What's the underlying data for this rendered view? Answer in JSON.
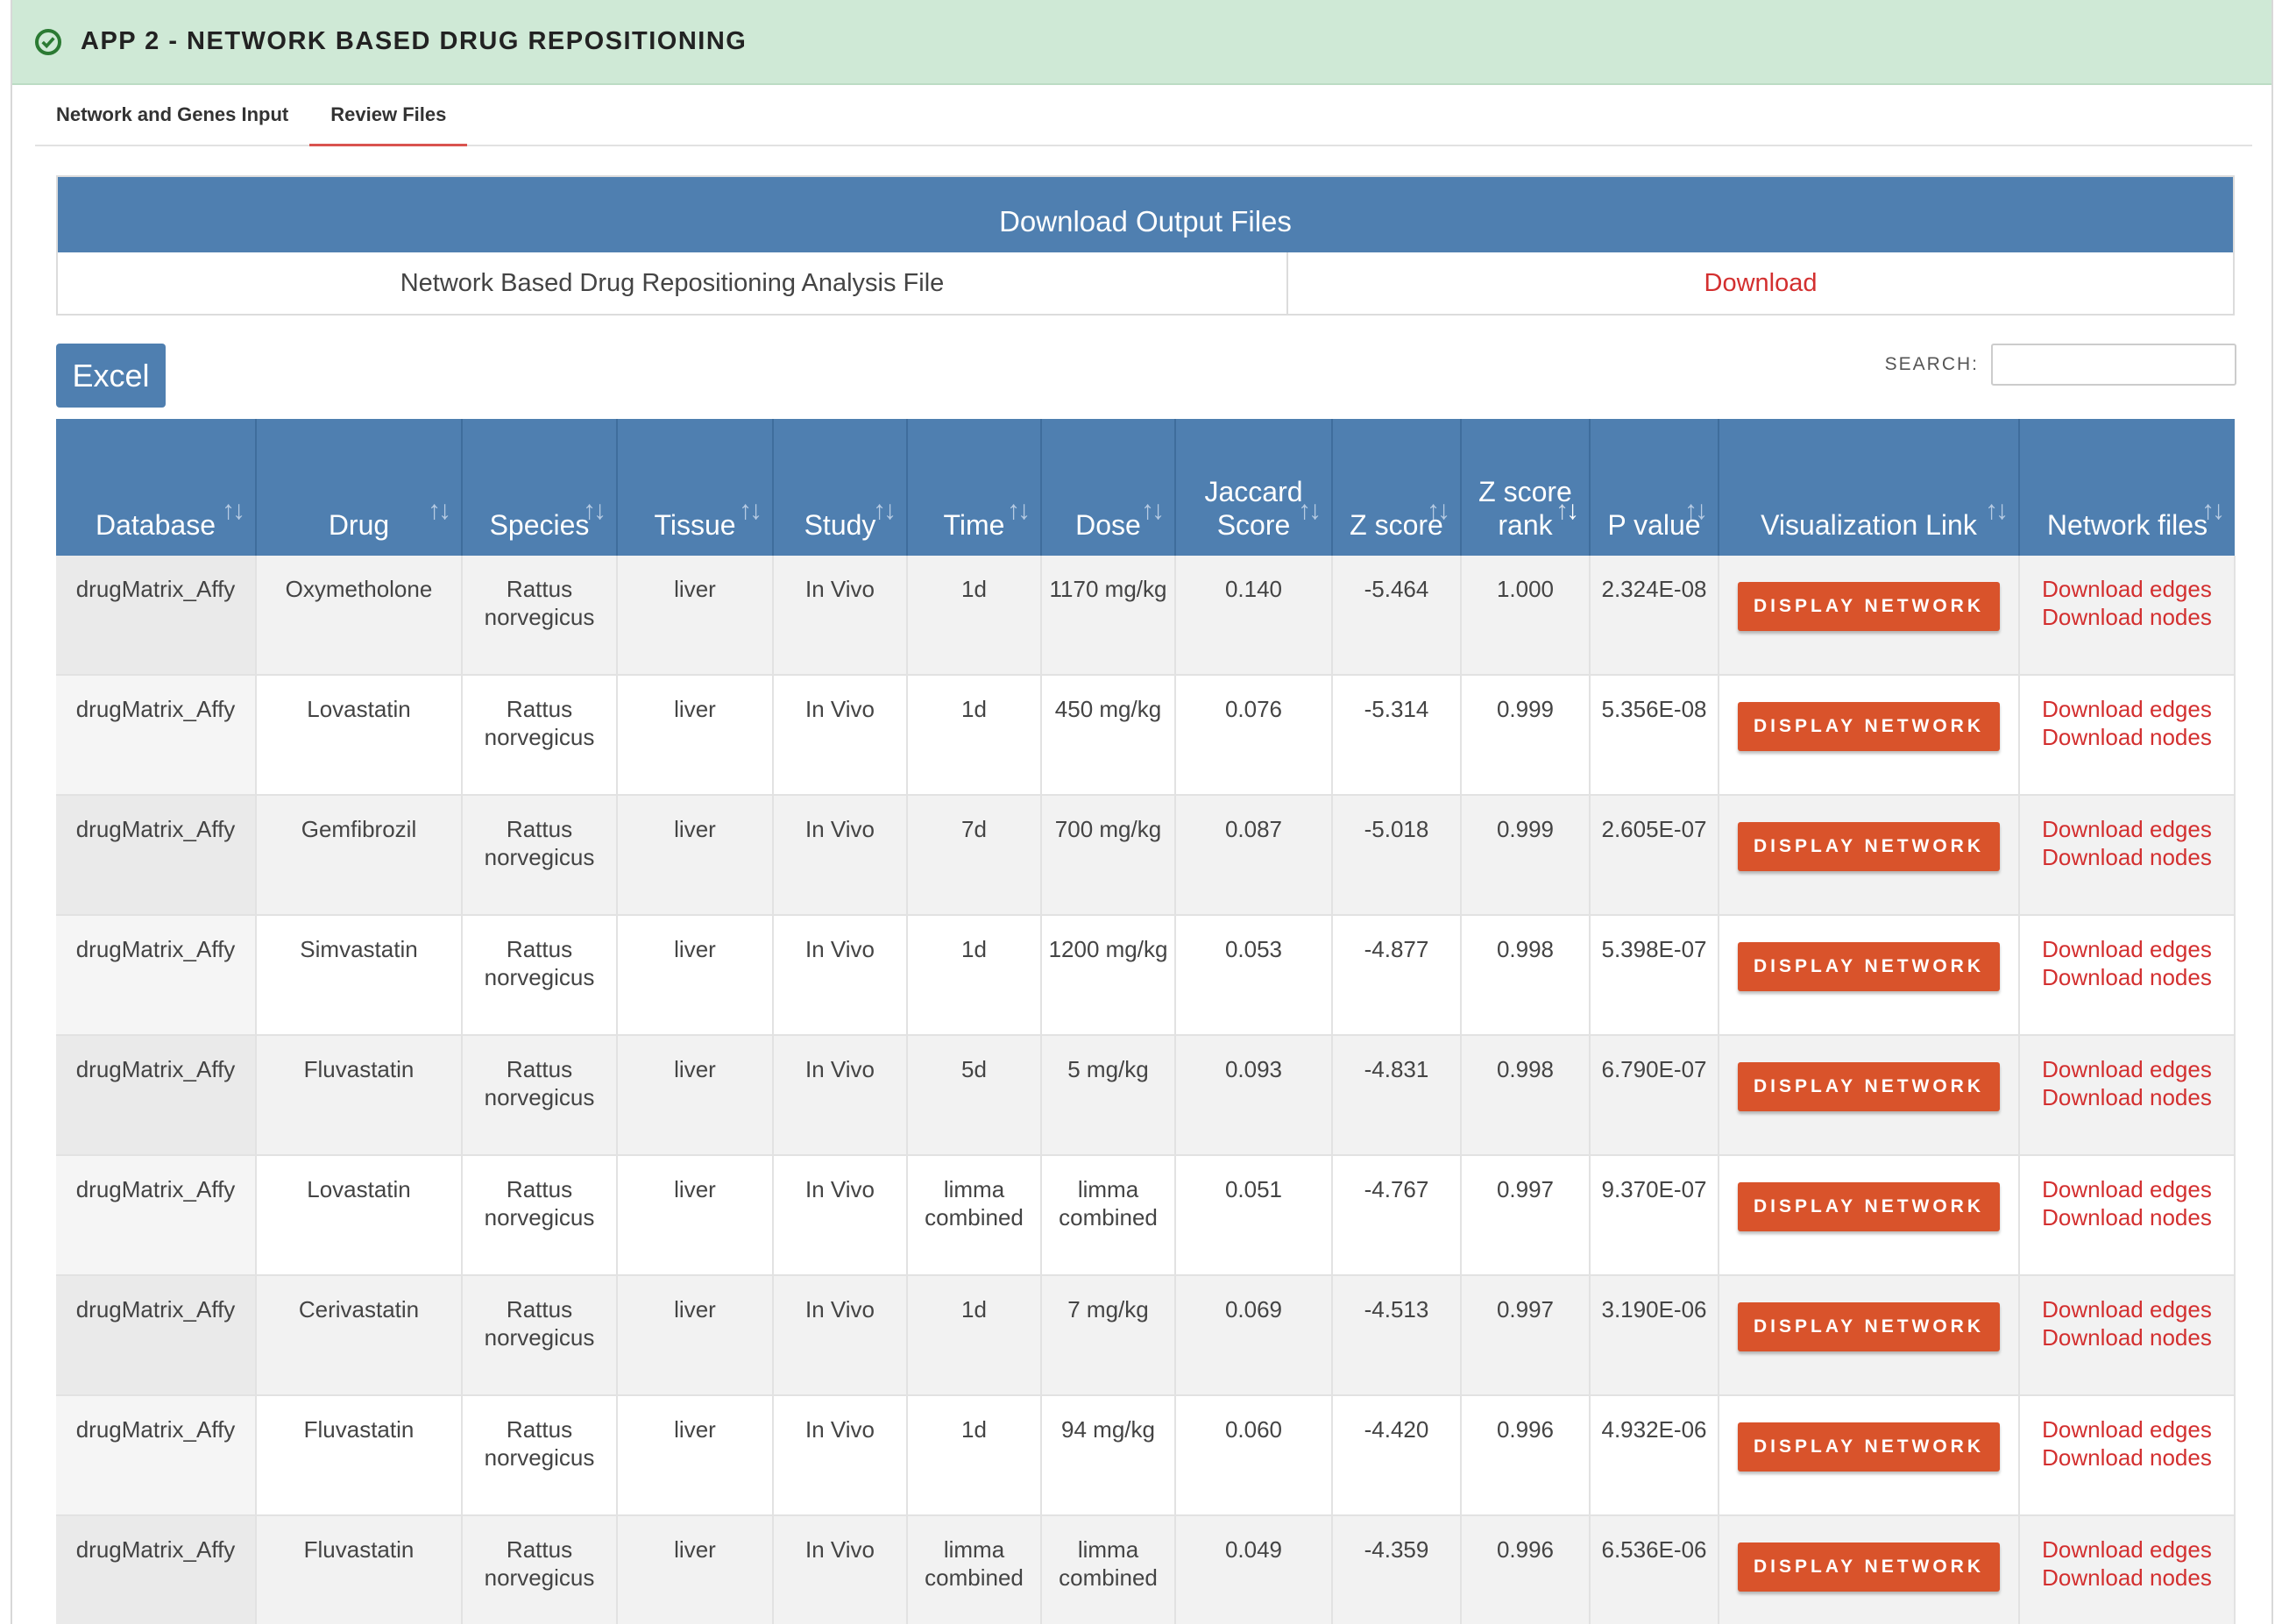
{
  "header": {
    "title": "APP 2 - NETWORK BASED DRUG REPOSITIONING"
  },
  "tabs": [
    {
      "label": "Network and Genes Input",
      "active": false
    },
    {
      "label": "Review Files",
      "active": true
    }
  ],
  "download_box": {
    "title": "Download Output Files",
    "file_label": "Network Based Drug Repositioning Analysis File",
    "link_label": "Download"
  },
  "excel_label": "Excel",
  "search": {
    "label": "SEARCH:",
    "value": ""
  },
  "table": {
    "columns": [
      "Database",
      "Drug",
      "Species",
      "Tissue",
      "Study",
      "Time",
      "Dose",
      "Jaccard Score",
      "Z score",
      "Z score rank",
      "P value",
      "Visualization Link",
      "Network files"
    ],
    "button_label": "DISPLAY NETWORK",
    "edges_label": "Download edges",
    "nodes_label": "Download nodes",
    "rows": [
      [
        "drugMatrix_Affy",
        "Oxymetholone",
        "Rattus norvegicus",
        "liver",
        "In Vivo",
        "1d",
        "1170 mg/kg",
        "0.140",
        "-5.464",
        "1.000",
        "2.324E-08"
      ],
      [
        "drugMatrix_Affy",
        "Lovastatin",
        "Rattus norvegicus",
        "liver",
        "In Vivo",
        "1d",
        "450 mg/kg",
        "0.076",
        "-5.314",
        "0.999",
        "5.356E-08"
      ],
      [
        "drugMatrix_Affy",
        "Gemfibrozil",
        "Rattus norvegicus",
        "liver",
        "In Vivo",
        "7d",
        "700 mg/kg",
        "0.087",
        "-5.018",
        "0.999",
        "2.605E-07"
      ],
      [
        "drugMatrix_Affy",
        "Simvastatin",
        "Rattus norvegicus",
        "liver",
        "In Vivo",
        "1d",
        "1200 mg/kg",
        "0.053",
        "-4.877",
        "0.998",
        "5.398E-07"
      ],
      [
        "drugMatrix_Affy",
        "Fluvastatin",
        "Rattus norvegicus",
        "liver",
        "In Vivo",
        "5d",
        "5 mg/kg",
        "0.093",
        "-4.831",
        "0.998",
        "6.790E-07"
      ],
      [
        "drugMatrix_Affy",
        "Lovastatin",
        "Rattus norvegicus",
        "liver",
        "In Vivo",
        "limma combined",
        "limma combined",
        "0.051",
        "-4.767",
        "0.997",
        "9.370E-07"
      ],
      [
        "drugMatrix_Affy",
        "Cerivastatin",
        "Rattus norvegicus",
        "liver",
        "In Vivo",
        "1d",
        "7 mg/kg",
        "0.069",
        "-4.513",
        "0.997",
        "3.190E-06"
      ],
      [
        "drugMatrix_Affy",
        "Fluvastatin",
        "Rattus norvegicus",
        "liver",
        "In Vivo",
        "1d",
        "94 mg/kg",
        "0.060",
        "-4.420",
        "0.996",
        "4.932E-06"
      ],
      [
        "drugMatrix_Affy",
        "Fluvastatin",
        "Rattus norvegicus",
        "liver",
        "In Vivo",
        "limma combined",
        "limma combined",
        "0.049",
        "-4.359",
        "0.996",
        "6.536E-06"
      ]
    ]
  },
  "colors": {
    "header_bg": "#cfe9d6",
    "table_header": "#4f7fb0",
    "button": "#d9532b",
    "link": "#d32f2f"
  }
}
